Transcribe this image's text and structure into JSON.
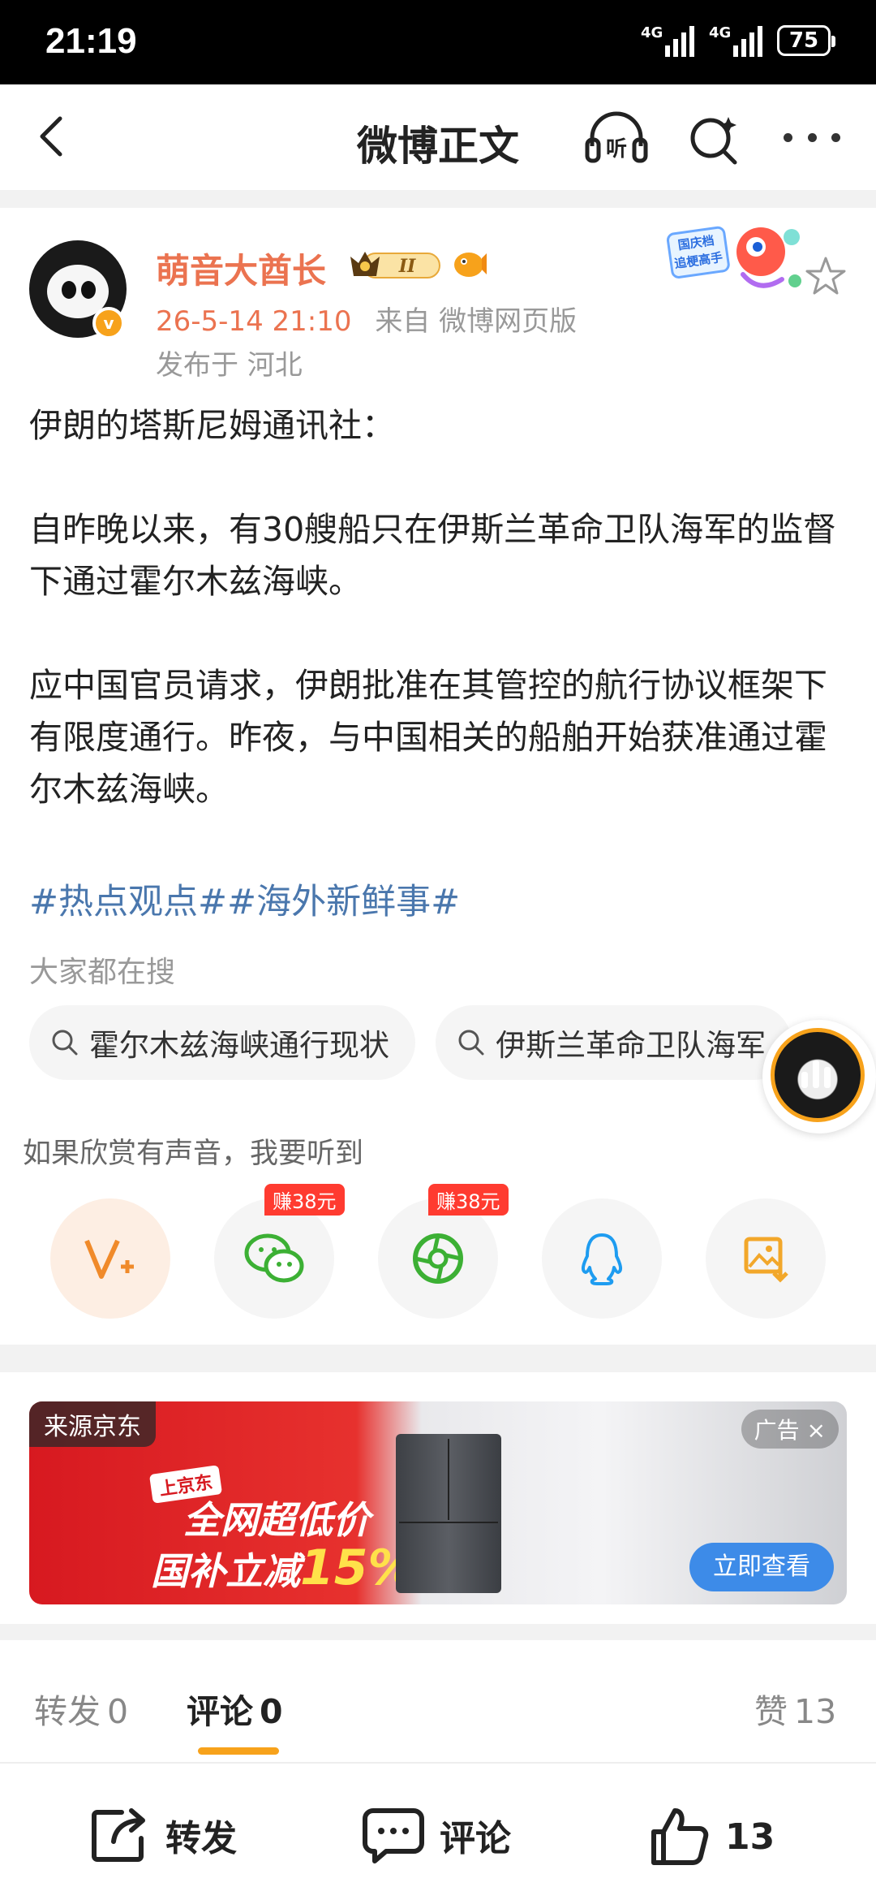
{
  "status_bar": {
    "time": "21:19",
    "net1": "4G",
    "net2": "4G",
    "battery": "75"
  },
  "header": {
    "title": "微博正文",
    "listen_label": "听"
  },
  "post": {
    "author": "萌音大酋长",
    "vip_level": "II",
    "time": "26-5-14 21:10",
    "source": "来自 微博网页版",
    "location": "发布于 河北",
    "sticker_text": "国庆档 追梗高手",
    "paragraphs": [
      "伊朗的塔斯尼姆通讯社：",
      "自昨晚以来，有30艘船只在伊斯兰革命卫队海军的监督下通过霍尔木兹海峡。",
      "应中国官员请求，伊朗批准在其管控的航行协议框架下有限度通行。昨夜，与中国相关的船舶开始获准通过霍尔木兹海峡。"
    ],
    "topics": "#热点观点##海外新鲜事#"
  },
  "search": {
    "title": "大家都在搜",
    "chips": [
      "霍尔木兹海峡通行现状",
      "伊斯兰革命卫队海军"
    ]
  },
  "share": {
    "tip": "如果欣赏有声音，我要听到",
    "earn_wechat": "赚38元",
    "earn_moments": "赚38元"
  },
  "ad": {
    "source": "来源京东",
    "label": "广告",
    "brand": "上京东",
    "headline1": "全网超低价",
    "headline2": "国补立减",
    "headline_pct": "15%",
    "cta": "立即查看"
  },
  "tabs": {
    "repost_label": "转发",
    "repost_count": "0",
    "comment_label": "评论",
    "comment_count": "0",
    "like_label": "赞",
    "like_count": "13"
  },
  "actions": {
    "repost": "转发",
    "comment": "评论",
    "like_count": "13"
  },
  "colors": {
    "accent": "#eb7350",
    "topic": "#4a77ad",
    "orange": "#f7a21b",
    "red_tag": "#ff3b30"
  }
}
